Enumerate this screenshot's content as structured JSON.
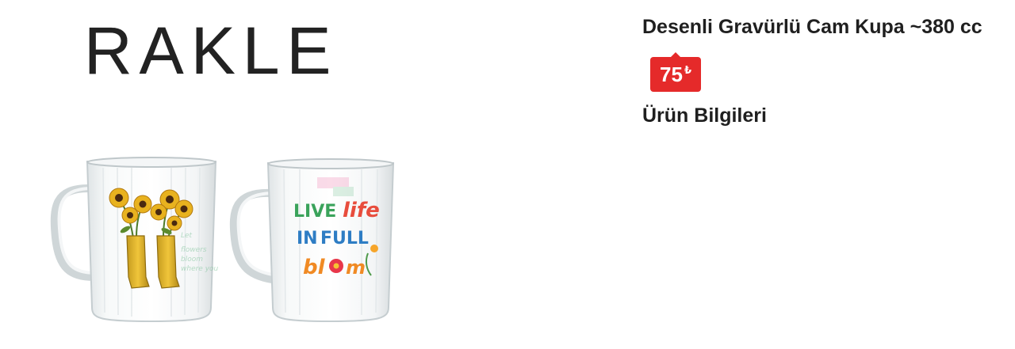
{
  "brand": {
    "logo_text": "RAKLE"
  },
  "product": {
    "title": "Desenli Gravürlü Cam Kupa ~380 cc",
    "price": {
      "value": "75",
      "currency": "₺",
      "badge_color": "#e52a2a"
    },
    "image_alt": "Two glass mugs with printed designs",
    "mug_left_print": [
      "grow",
      "bloom",
      "wild"
    ],
    "mug_right_print": [
      "LIVE",
      "life",
      "IN",
      "FULL",
      "bloom"
    ]
  },
  "sections": {
    "info_heading": "Ürün Bilgileri"
  }
}
